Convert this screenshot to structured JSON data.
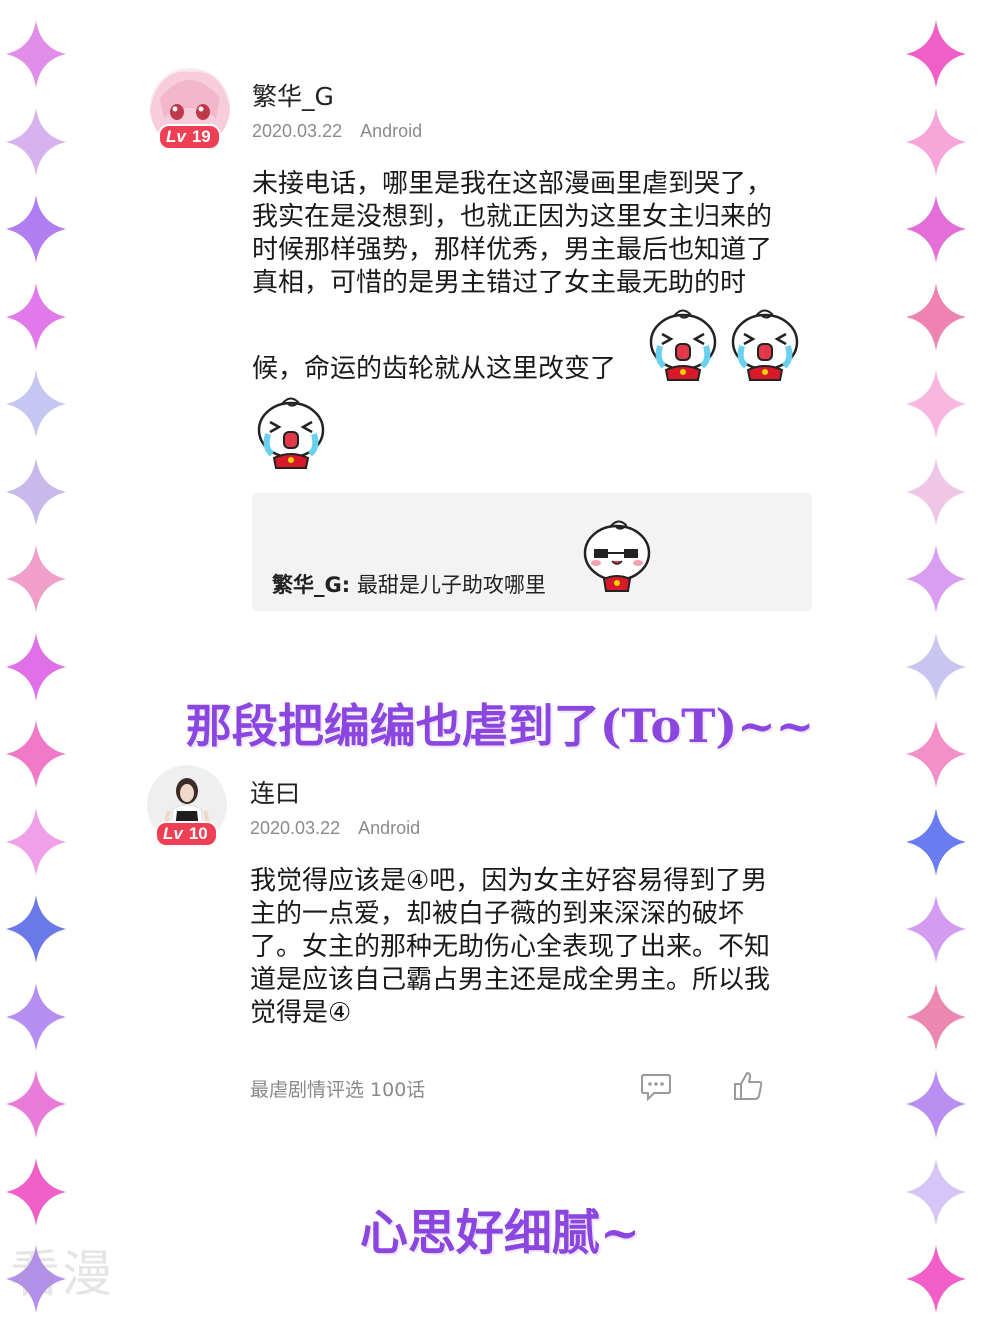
{
  "colors": {
    "accent_caption": "#8b46e0",
    "level_badge": "#ef3f55",
    "reply_background": "#f3f3f3",
    "sparkles_left": [
      "#e08ee8",
      "#d7b2ee",
      "#b07ef0",
      "#e279ea",
      "#c6c6f2",
      "#c8b8ec",
      "#f0a0c8",
      "#e070e8",
      "#f07ac8",
      "#f0a0e8",
      "#6a78e8",
      "#b48ef0",
      "#e87cd8",
      "#f060c8",
      "#b48ef0"
    ],
    "sparkles_right": [
      "#f05ec8",
      "#f6a6d8",
      "#e46ed8",
      "#ee82b0",
      "#f8b6e0",
      "#f0c6e8",
      "#da9ef0",
      "#c8c6f0",
      "#f490c8",
      "#6a7cf0",
      "#d49cf0",
      "#ec88b0",
      "#b88ef0",
      "#d6c6f8",
      "#f060c8"
    ]
  },
  "comments": [
    {
      "username": "繁华_G",
      "level_prefix": "Lv",
      "level": "19",
      "date": "2020.03.22",
      "platform": "Android",
      "text_lines": [
        "未接电话，哪里是我在这部漫画里虐到哭了，",
        "我实在是没想到，也就正因为这里女主归来的",
        "时候那样强势，那样优秀，男主最后也知道了",
        "真相，可惜的是男主错过了女主最无助的时",
        "候，命运的齿轮就从这里改变了"
      ],
      "reply": {
        "author": "繁华_G:",
        "text": "最甜是儿子助攻哪里"
      }
    },
    {
      "username": "连曰",
      "level_prefix": "Lv",
      "level": "10",
      "date": "2020.03.22",
      "platform": "Android",
      "text_lines": [
        "我觉得应该是④吧，因为女主好容易得到了男",
        "主的一点爱，却被白子薇的到来深深的破坏",
        "了。女主的那种无助伤心全表现了出来。不知",
        "道是应该自己霸占男主还是成全男主。所以我",
        "觉得是④"
      ],
      "footer_tag": "最虐剧情评选  100话"
    }
  ],
  "captions": {
    "first": "那段把编编也虐到了(ToT)~~",
    "second": "心思好细腻~"
  },
  "icons": {
    "comment_icon": "speech-bubble",
    "like_icon": "thumbs-up",
    "emoji_cry": "crying-bun",
    "emoji_happy": "happy-bun",
    "decor": "four-point-sparkle"
  },
  "watermark": "看漫"
}
